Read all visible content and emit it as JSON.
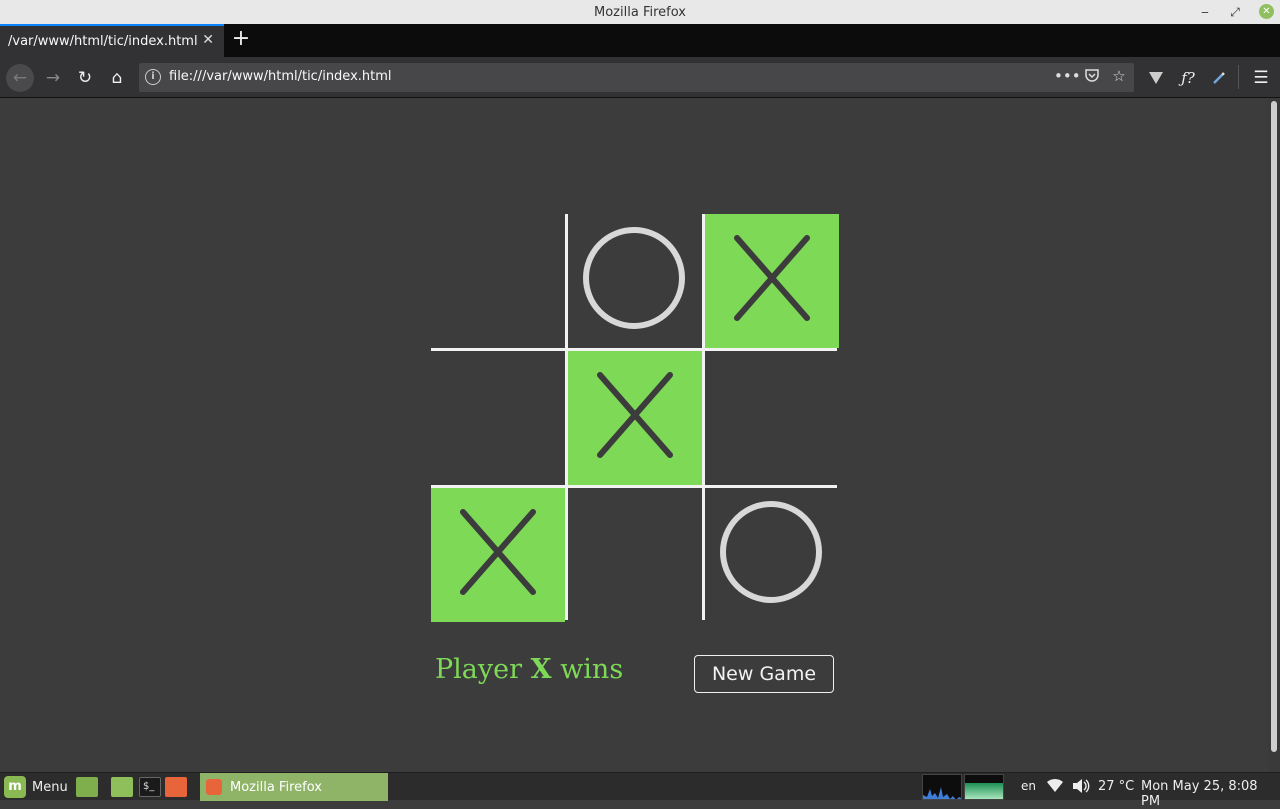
{
  "window": {
    "title": "Mozilla Firefox"
  },
  "tabs": [
    {
      "label": "/var/www/html/tic/index.html"
    }
  ],
  "navbar": {
    "url": "file:///var/www/html/tic/index.html",
    "page_actions_icon": "•••"
  },
  "game": {
    "board": [
      [
        "",
        "O",
        "X"
      ],
      [
        "",
        "X",
        ""
      ],
      [
        "X",
        "",
        "O"
      ]
    ],
    "winning_cells": [
      [
        0,
        2
      ],
      [
        1,
        1
      ],
      [
        2,
        0
      ]
    ],
    "status_prefix": "Player",
    "winner": "X",
    "status_suffix": "wins",
    "new_game_label": "New Game"
  },
  "taskbar": {
    "menu_label": "Menu",
    "window_button_label": "Mozilla Firefox",
    "keyboard_layout": "en",
    "temperature": "27 °C",
    "clock": "Mon May 25,  8:08 PM"
  },
  "colors": {
    "win_cell": "#7ed957",
    "mark_x": "#3c3c3c",
    "mark_o": "#d8d8d8",
    "grid": "#f2f2f2"
  }
}
